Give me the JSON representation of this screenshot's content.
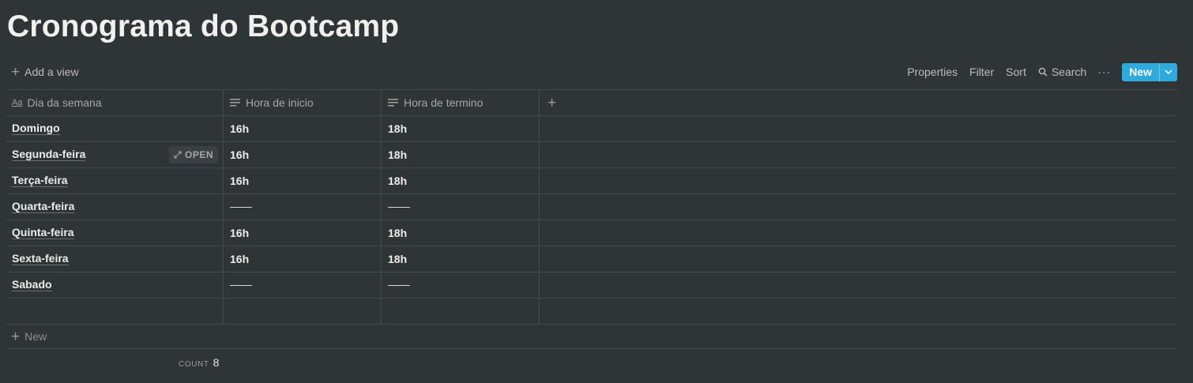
{
  "page": {
    "title": "Cronograma do Bootcamp"
  },
  "toolbar": {
    "add_view": "Add a view",
    "properties": "Properties",
    "filter": "Filter",
    "sort": "Sort",
    "search": "Search",
    "more": "···",
    "new": "New"
  },
  "columns": {
    "c1": "Dia da semana",
    "c1_icon_text": "Aa",
    "c2": "Hora de inicio",
    "c3": "Hora de termino",
    "add": "+"
  },
  "open_label": "OPEN",
  "rows": [
    {
      "dia": "Domingo",
      "inicio": "16h",
      "termino": "18h"
    },
    {
      "dia": "Segunda-feira",
      "inicio": "16h",
      "termino": "18h"
    },
    {
      "dia": "Terça-feira",
      "inicio": "16h",
      "termino": "18h"
    },
    {
      "dia": "Quarta-feira",
      "inicio": "",
      "termino": ""
    },
    {
      "dia": "Quinta-feira",
      "inicio": "16h",
      "termino": "18h"
    },
    {
      "dia": "Sexta-feira",
      "inicio": "16h",
      "termino": "18h"
    },
    {
      "dia": "Sabado",
      "inicio": "",
      "termino": ""
    },
    {
      "dia": "",
      "inicio": "",
      "termino": ""
    }
  ],
  "footer": {
    "new_row": "New",
    "count_label": "COUNT",
    "count_value": "8"
  },
  "colors": {
    "accent": "#2eaadc",
    "background": "#2f3437"
  }
}
